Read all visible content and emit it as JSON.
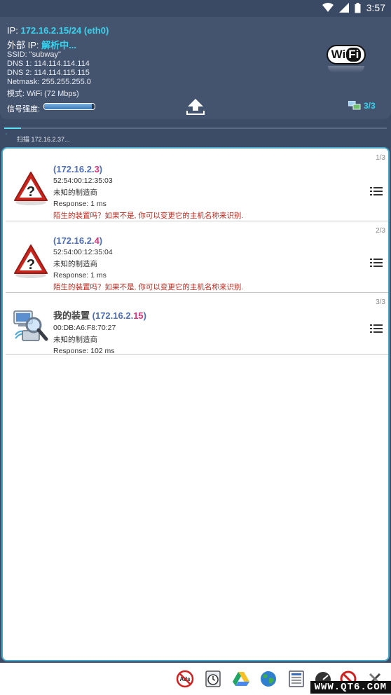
{
  "status_bar": {
    "time": "3:57"
  },
  "header": {
    "ip_label": "IP:",
    "ip_value": "172.16.2.15/24 (eth0)",
    "external_label": "外部 IP:",
    "external_value": "解析中...",
    "ssid": "SSID: \"subway\"",
    "dns1": "DNS 1: 114.114.114.114",
    "dns2": "DNS 2: 114.114.115.115",
    "netmask": "Netmask: 255.255.255.0",
    "mode": "模式: WiFi (72 Mbps)",
    "signal_label": "信号强度:",
    "signal_level": 0.95,
    "devices_count": "3/3"
  },
  "scan": {
    "text": "扫描 172.16.2.37..."
  },
  "devices": [
    {
      "count": "1/3",
      "name": "",
      "ip_prefix": "172.16.2.",
      "ip_last": "3",
      "mac": "52:54:00:12:35:03",
      "vendor": "未知的制造商",
      "response": "Response: 1 ms",
      "warning": "陌生的装置吗？如果不是, 你可以变更它的主机名称来识别."
    },
    {
      "count": "2/3",
      "name": "",
      "ip_prefix": "172.16.2.",
      "ip_last": "4",
      "mac": "52:54:00:12:35:04",
      "vendor": "未知的制造商",
      "response": "Response: 1 ms",
      "warning": "陌生的装置吗？如果不是, 你可以变更它的主机名称来识别."
    },
    {
      "count": "3/3",
      "name": "我的装置 ",
      "ip_prefix": "172.16.2.",
      "ip_last": "15",
      "mac": "00:DB:A6:F8:70:27",
      "vendor": "未知的制造商",
      "response": "Response: 102 ms",
      "warning": ""
    }
  ],
  "bottom_bar": {
    "ads_label": "Ads",
    "watermark": "WWW.QT6.COM"
  },
  "logo": {
    "wi": "Wi",
    "fi": "Fi"
  }
}
